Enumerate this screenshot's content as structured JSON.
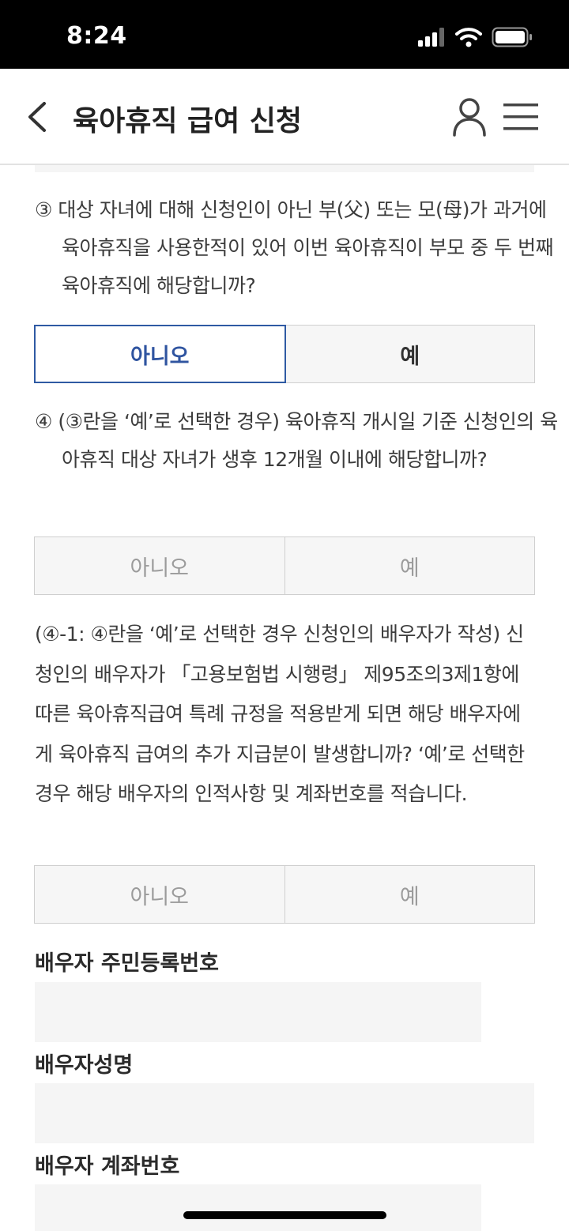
{
  "status_bar": {
    "time": "8:24"
  },
  "header": {
    "title": "육아휴직 급여 신청"
  },
  "q3": {
    "text": "③ 대상 자녀에 대해 신청인이 아닌 부(父) 또는 모(母)가 과거에 육아휴직을 사용한적이 있어 이번 육아휴직이 부모 중 두 번째 육아휴직에 해당합니까?",
    "no_label": "아니오",
    "yes_label": "예",
    "selected": "아니오"
  },
  "q4": {
    "text": "④ (③란을 ‘예’로 선택한 경우) 육아휴직 개시일 기준 신청인의 육아휴직 대상 자녀가 생후 12개월 이내에 해당합니까?",
    "no_label": "아니오",
    "yes_label": "예"
  },
  "q4_1": {
    "text": "(④-1: ④란을 ‘예’로 선택한 경우 신청인의 배우자가 작성) 신청인의 배우자가 「고용보험법 시행령」 제95조의3제1항에 따른 육아휴직급여 특례 규정을 적용받게 되면 해당 배우자에게 육아휴직 급여의 추가 지급분이 발생합니까? ‘예’로 선택한 경우 해당 배우자의 인적사항 및 계좌번호를 적습니다.",
    "no_label": "아니오",
    "yes_label": "예"
  },
  "fields": {
    "spouse_rrn_label": "배우자 주민등록번호",
    "spouse_rrn_value": "",
    "spouse_name_label": "배우자성명",
    "spouse_name_value": "",
    "spouse_account_label": "배우자 계좌번호",
    "spouse_account_value": ""
  },
  "colors": {
    "accent": "#2f5aa3",
    "input_bg": "#f5f5f5",
    "border": "#cfcfcf"
  },
  "icons": [
    "back-chevron-icon",
    "user-icon",
    "menu-icon",
    "signal-icon",
    "wifi-icon",
    "battery-icon"
  ]
}
